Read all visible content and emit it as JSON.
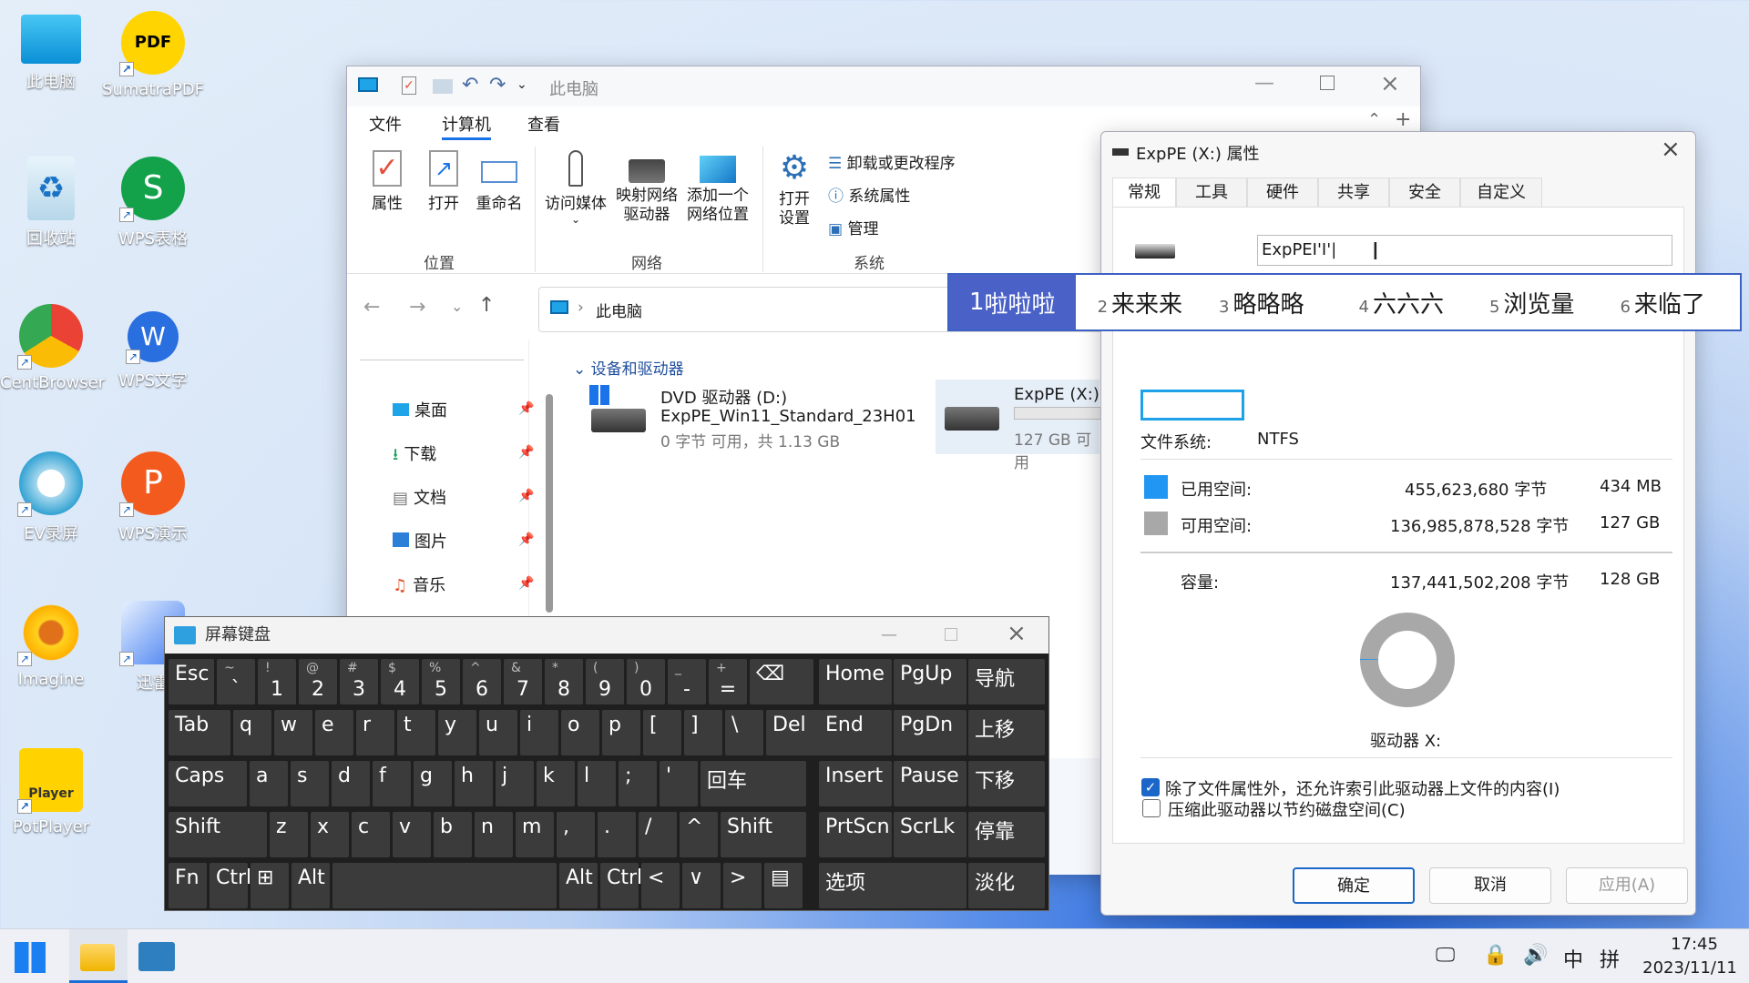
{
  "desktop": {
    "icons": [
      {
        "label": "此电脑"
      },
      {
        "label": "SumatraPDF"
      },
      {
        "label": "回收站"
      },
      {
        "label": "WPS表格"
      },
      {
        "label": "CentBrowser"
      },
      {
        "label": "WPS文字"
      },
      {
        "label": "EV录屏"
      },
      {
        "label": "WPS演示"
      },
      {
        "label": "Imagine"
      },
      {
        "label": "迅雷"
      },
      {
        "label": "PotPlayer"
      }
    ]
  },
  "explorer": {
    "title": "此电脑",
    "menu_tabs": [
      "文件",
      "计算机",
      "查看"
    ],
    "ribbon": {
      "btn_properties": "属性",
      "btn_open": "打开",
      "btn_rename": "重命名",
      "group_location": "位置",
      "btn_media": "访问媒体",
      "btn_map": "映射网络\n驱动器",
      "btn_add": "添加一个\n网络位置",
      "group_network": "网络",
      "btn_settings": "打开\n设置",
      "link_uninstall": "卸载或更改程序",
      "link_sysprops": "系统属性",
      "link_manage": "管理",
      "group_system": "系统"
    },
    "address": "此电脑",
    "nav": [
      {
        "label": "桌面"
      },
      {
        "label": "下载"
      },
      {
        "label": "文档"
      },
      {
        "label": "图片"
      },
      {
        "label": "音乐"
      }
    ],
    "section_header": "设备和驱动器",
    "drives": {
      "dvd_name": "DVD 驱动器 (D:)",
      "dvd_label": "ExpPE_Win11_Standard_23H01",
      "dvd_space": "0 字节 可用，共 1.13 GB",
      "x_name": "ExpPE (X:)",
      "x_space": "127 GB 可用"
    }
  },
  "properties": {
    "title": "ExpPE (X:) 属性",
    "tabs": [
      "常规",
      "工具",
      "硬件",
      "共享",
      "安全",
      "自定义"
    ],
    "label_value": "ExpPEI'I'|",
    "filesystem_label": "文件系统:",
    "filesystem_value": "NTFS",
    "used_label": "已用空间:",
    "used_bytes": "455,623,680 字节",
    "used_size": "434 MB",
    "free_label": "可用空间:",
    "free_bytes": "136,985,878,528 字节",
    "free_size": "127 GB",
    "capacity_label": "容量:",
    "capacity_bytes": "137,441,502,208 字节",
    "capacity_size": "128 GB",
    "drive_label": "驱动器 X:",
    "compress_label": "压缩此驱动器以节约磁盘空间(C)",
    "index_label": "除了文件属性外，还允许索引此驱动器上文件的内容(I)",
    "ok": "确定",
    "cancel": "取消",
    "apply": "应用(A)",
    "used_fraction": 0.0033,
    "used_color": "#2196f3",
    "free_color": "#a8a8a8"
  },
  "ime": {
    "candidates": [
      {
        "n": "1",
        "text": "啦啦啦"
      },
      {
        "n": "2",
        "text": "来来来"
      },
      {
        "n": "3",
        "text": "略略略"
      },
      {
        "n": "4",
        "text": "六六六"
      },
      {
        "n": "5",
        "text": "浏览量"
      },
      {
        "n": "6",
        "text": "来临了"
      }
    ]
  },
  "osk": {
    "title": "屏幕键盘",
    "row1": [
      {
        "s": "",
        "m": "Esc"
      },
      {
        "s": "~",
        "m": "`"
      },
      {
        "s": "!",
        "m": "1"
      },
      {
        "s": "@",
        "m": "2"
      },
      {
        "s": "#",
        "m": "3"
      },
      {
        "s": "$",
        "m": "4"
      },
      {
        "s": "%",
        "m": "5"
      },
      {
        "s": "^",
        "m": "6"
      },
      {
        "s": "&",
        "m": "7"
      },
      {
        "s": "*",
        "m": "8"
      },
      {
        "s": "(",
        "m": "9"
      },
      {
        "s": ")",
        "m": "0"
      },
      {
        "s": "_",
        "m": "-"
      },
      {
        "s": "+",
        "m": "="
      },
      {
        "s": "",
        "m": "⌫"
      }
    ],
    "row2": [
      "Tab",
      "q",
      "w",
      "e",
      "r",
      "t",
      "y",
      "u",
      "i",
      "o",
      "p",
      "[",
      "]",
      "\\",
      "Del"
    ],
    "row3": [
      "Caps",
      "a",
      "s",
      "d",
      "f",
      "g",
      "h",
      "j",
      "k",
      "l",
      ";",
      "'",
      "回车"
    ],
    "row4": [
      "Shift",
      "z",
      "x",
      "c",
      "v",
      "b",
      "n",
      "m",
      ",",
      ".",
      "/",
      "^",
      "Shift"
    ],
    "row5": [
      "Fn",
      "Ctrl",
      "⊞",
      "Alt",
      "",
      "Alt",
      "Ctrl",
      "<",
      "∨",
      ">",
      "▤"
    ],
    "nav_keys": [
      "Home",
      "PgUp",
      "导航",
      "End",
      "PgDn",
      "上移",
      "Insert",
      "Pause",
      "下移",
      "PrtScn",
      "ScrLk",
      "停靠",
      "选项",
      "淡化"
    ]
  },
  "taskbar": {
    "time": "17:45",
    "date": "2023/11/11",
    "tray_ime_lang": "中",
    "tray_ime_mode": "拼"
  }
}
